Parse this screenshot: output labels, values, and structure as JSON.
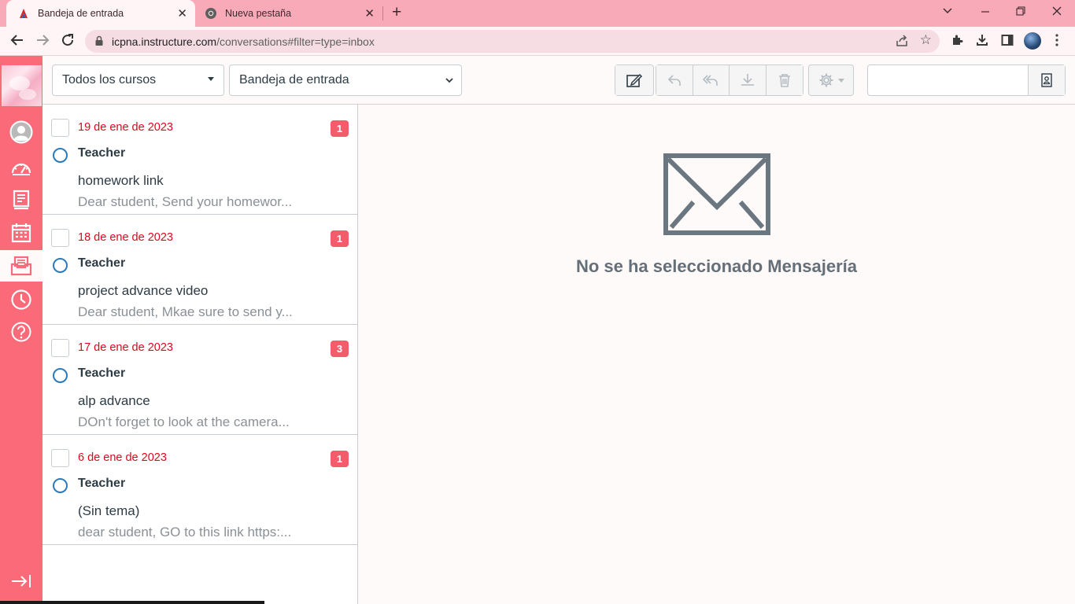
{
  "browser": {
    "tabs": [
      {
        "title": "Bandeja de entrada",
        "active": true
      },
      {
        "title": "Nueva pestaña",
        "active": false
      }
    ],
    "url_host": "icpna.instructure.com",
    "url_path": "/conversations#filter=type=inbox"
  },
  "toolbar": {
    "course_select": "Todos los cursos",
    "mailbox_select": "Bandeja de entrada",
    "search_value": ""
  },
  "messages": [
    {
      "date": "19 de ene de 2023",
      "count": "1",
      "author": "Teacher",
      "subject": "homework link",
      "preview": "Dear student, Send your homewor..."
    },
    {
      "date": "18 de ene de 2023",
      "count": "1",
      "author": "Teacher",
      "subject": "project advance video",
      "preview": "Dear student, Mkae sure to send y..."
    },
    {
      "date": "17 de ene de 2023",
      "count": "3",
      "author": "Teacher",
      "subject": "alp advance",
      "preview": "DOn't forget to look at the camera..."
    },
    {
      "date": "6 de ene de 2023",
      "count": "1",
      "author": "Teacher",
      "subject": "(Sin tema)",
      "preview": "dear student, GO to this link https:..."
    }
  ],
  "empty_state": {
    "title": "No se ha seleccionado Mensajería",
    "icon": "envelope-icon"
  },
  "colors": {
    "nav_bg": "#fb6a78",
    "date_red": "#e0061f",
    "badge": "#f45c6b",
    "unread_ring": "#2b7abc"
  }
}
